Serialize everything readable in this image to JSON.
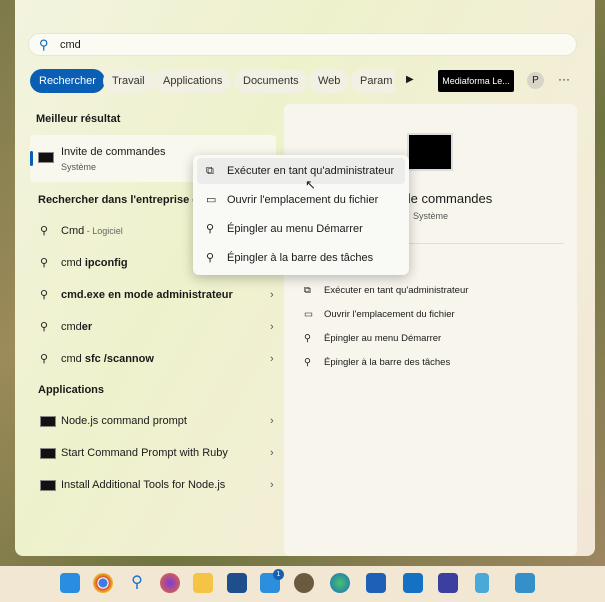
{
  "search": {
    "value": "cmd"
  },
  "chips": [
    "Rechercher",
    "Travail",
    "Applications",
    "Documents",
    "Web",
    "Param"
  ],
  "account": {
    "org": "Mediaforma Le...",
    "avatar": "P"
  },
  "best": {
    "heading": "Meilleur résultat",
    "name": "Invite de commandes",
    "type": "Système"
  },
  "web": {
    "heading": "Rechercher dans l'entreprise et s",
    "items": [
      {
        "text": "Cmd",
        "suffix": " - Logiciel"
      },
      {
        "text": "cmd ",
        "bold": "ipconfig"
      },
      {
        "text": "",
        "bold": "cmd.exe en mode administrateur"
      },
      {
        "text": "cmd",
        "bold": "er"
      },
      {
        "text": "cmd ",
        "bold": "sfc /scannow"
      }
    ]
  },
  "apps": {
    "heading": "Applications",
    "items": [
      "Node.js command prompt",
      "Start Command Prompt with Ruby",
      "Install Additional Tools for Node.js"
    ]
  },
  "detail": {
    "title": "Invite de commandes",
    "type": "Système",
    "actions": [
      "Exécuter en tant qu'administrateur",
      "Ouvrir l'emplacement du fichier",
      "Épingler au menu Démarrer",
      "Épingler à la barre des tâches"
    ]
  },
  "context_menu": [
    "Exécuter en tant qu'administrateur",
    "Ouvrir l'emplacement du fichier",
    "Épingler au menu Démarrer",
    "Épingler à la barre des tâches"
  ],
  "taskbar": {
    "mail_badge": "1",
    "icons": [
      "start",
      "chrome",
      "search",
      "firefox",
      "explorer",
      "store",
      "mail",
      "paint",
      "edge",
      "word",
      "outlook",
      "floppy",
      "notepad",
      "remote"
    ]
  }
}
